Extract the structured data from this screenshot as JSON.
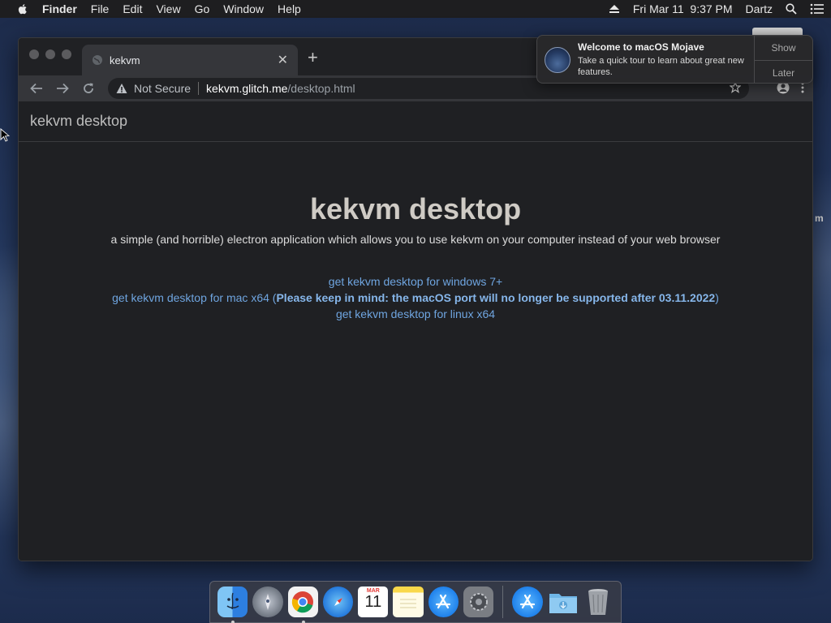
{
  "menubar": {
    "app_name": "Finder",
    "items": [
      "File",
      "Edit",
      "View",
      "Go",
      "Window",
      "Help"
    ],
    "datetime": "Fri Mar 11  9:37 PM",
    "user": "Dartz"
  },
  "browser": {
    "tab": {
      "title": "kekvm"
    },
    "address": {
      "security_label": "Not Secure",
      "host": "kekvm.glitch.me",
      "path": "/desktop.html"
    }
  },
  "page": {
    "header_title": "kekvm desktop",
    "hero_title": "kekvm desktop",
    "tagline": "a simple (and horrible) electron application which allows you to use kekvm on your computer instead of your web browser",
    "links": {
      "windows": "get kekvm desktop for windows 7+",
      "mac": "get kekvm desktop for mac x64",
      "mac_note": "Please keep in mind: the macOS port will no longer be supported after 03.11.2022",
      "linux": "get kekvm desktop for linux x64"
    }
  },
  "notification": {
    "title": "Welcome to macOS Mojave",
    "body": "Take a quick tour to learn about great new features.",
    "show_label": "Show",
    "later_label": "Later"
  },
  "dock": {
    "calendar_month": "MAR",
    "calendar_day": "11",
    "items": [
      "finder-icon",
      "launchpad-icon",
      "chrome-icon",
      "safari-icon",
      "calendar-icon",
      "notes-icon",
      "app-store-icon",
      "system-preferences-icon",
      "app-store-icon",
      "downloads-folder-icon",
      "trash-icon"
    ]
  },
  "side_letter": "m",
  "colors": {
    "link": "#6fa5e0",
    "page_bg": "#1f2023",
    "menubar_bg": "#1e1e20"
  }
}
